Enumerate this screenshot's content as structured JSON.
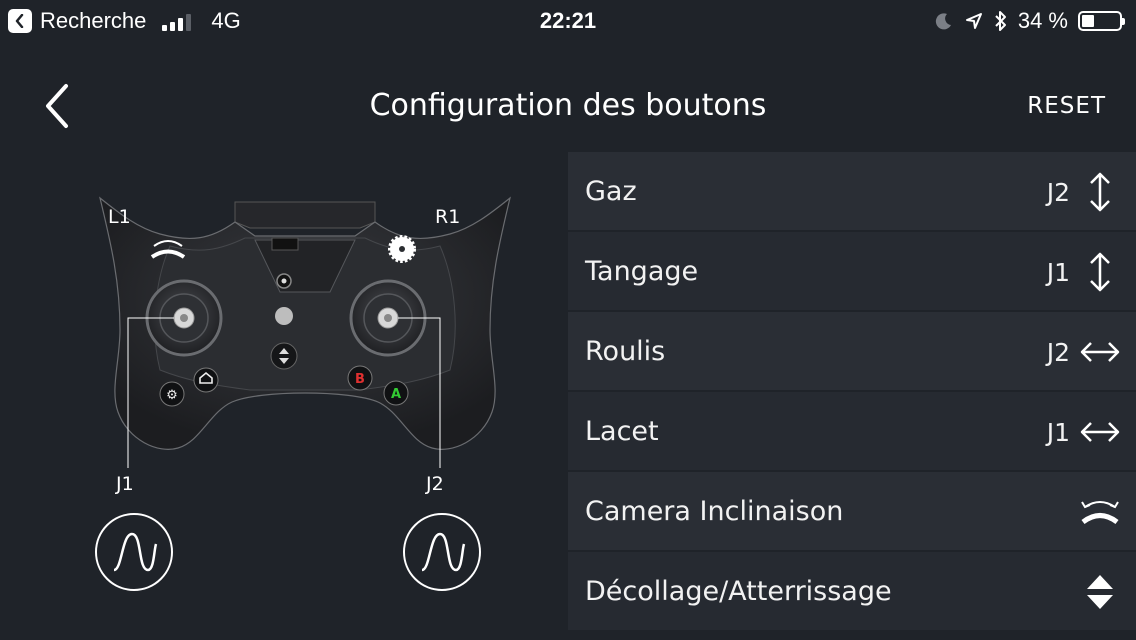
{
  "status_bar": {
    "back_app": "Recherche",
    "network": "4G",
    "time": "22:21",
    "battery": "34 %",
    "battery_level": 0.34
  },
  "header": {
    "title": "Configuration des boutons",
    "reset_label": "RESET"
  },
  "controller": {
    "l1": "L1",
    "r1": "R1",
    "j1": "J1",
    "j2": "J2"
  },
  "mappings": [
    {
      "label": "Gaz",
      "value": "J2",
      "icon": "vertical-arrows-icon"
    },
    {
      "label": "Tangage",
      "value": "J1",
      "icon": "vertical-arrows-icon"
    },
    {
      "label": "Roulis",
      "value": "J2",
      "icon": "horizontal-arrows-icon"
    },
    {
      "label": "Lacet",
      "value": "J1",
      "icon": "horizontal-arrows-icon"
    },
    {
      "label": "Camera Inclinaison",
      "value": "",
      "icon": "camera-tilt-icon"
    },
    {
      "label": "Décollage/Atterrissage",
      "value": "",
      "icon": "takeoff-landing-icon"
    }
  ],
  "colors": {
    "background": "#1f2329",
    "row": "#2a2e35",
    "controller_body": "#2b2d31",
    "button_b": "#e03030",
    "button_a": "#33cc33"
  }
}
